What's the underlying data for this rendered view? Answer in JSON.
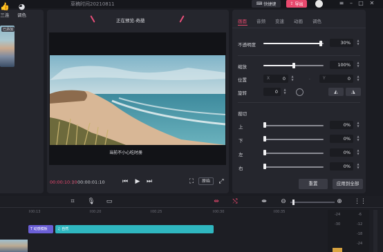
{
  "titlebar": {
    "title": "草稿时间20210811",
    "shortcut_label": "快捷键",
    "export_label": "导出"
  },
  "left_panel": {
    "tabs": [
      {
        "label": "三连",
        "icon": "thumbs-up-icon"
      },
      {
        "label": "调色",
        "icon": "palette-icon"
      }
    ],
    "media_badge": "已添加"
  },
  "player": {
    "title": "正在预览-奇葩",
    "subtitle_text": "当前不小心吃时册",
    "time_current": "00:00:10:10",
    "time_separator": "/",
    "time_total": "00:00:01:10",
    "ratio_label": "原始"
  },
  "properties": {
    "tabs": [
      "画面",
      "音频",
      "变速",
      "动画",
      "调色"
    ],
    "active_tab": 0,
    "opacity": {
      "label": "不透明度",
      "value": "30%",
      "level": 0.95
    },
    "scale": {
      "label": "缩放",
      "value": "100%",
      "level": 0.5
    },
    "position": {
      "label": "位置",
      "x_prefix": "X",
      "x": "0",
      "y_prefix": "Y",
      "y": "0"
    },
    "rotation": {
      "label": "旋转",
      "value": "0"
    },
    "crop": {
      "label": "裁切",
      "rows": [
        {
          "label": "上",
          "value": "0%"
        },
        {
          "label": "下",
          "value": "0%"
        },
        {
          "label": "左",
          "value": "0%"
        },
        {
          "label": "右",
          "value": "0%"
        }
      ]
    },
    "reset_label": "重置",
    "apply_all_label": "应用到全部"
  },
  "timeline": {
    "ruler_labels": [
      "00:13",
      "00:20",
      "00:25",
      "00:30",
      "00:35"
    ],
    "subtitle_clip_label": "动感模板",
    "audio_clip_label": "自然",
    "meter_labels_left": [
      "-24",
      "-30"
    ],
    "meter_labels_right": [
      "-6",
      "-12",
      "-18",
      "-24"
    ]
  },
  "colors": {
    "accent": "#e8496e",
    "audio_clip": "#2fb7c0",
    "subtitle_clip": "#6b5fd6",
    "panel_bg": "#25262d"
  }
}
